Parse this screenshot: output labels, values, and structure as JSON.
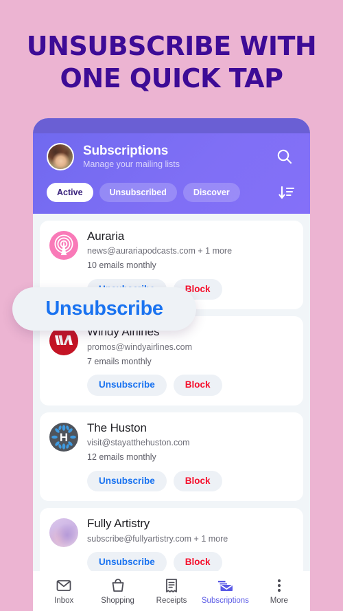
{
  "headline": {
    "line1": "Unsubscribe with",
    "line2": "One Quick Tap"
  },
  "colors": {
    "background_pink": "#ecb4d2",
    "headline_purple": "#3d0b96",
    "header_purple": "#7f6ff5",
    "status_bar_purple": "#6a5fd4",
    "accent_blue": "#1a73f0",
    "accent_red": "#f5102c",
    "nav_active": "#5a5ae6",
    "list_background": "#f1f5f8"
  },
  "app": {
    "header": {
      "avatar_name": "user-avatar",
      "title": "Subscriptions",
      "subtitle": "Manage your mailing lists",
      "search_icon": "search-icon",
      "sort_icon": "sort-descending-icon"
    },
    "filters": [
      {
        "label": "Active",
        "selected": true
      },
      {
        "label": "Unsubscribed",
        "selected": false
      },
      {
        "label": "Discover",
        "selected": false
      }
    ],
    "subscriptions": [
      {
        "name": "Auraria",
        "email": "news@aurariapodcasts.com + 1 more",
        "frequency": "10 emails monthly",
        "logo": "podcast-broadcast-icon",
        "unsubscribe_label": "Unsubscribe",
        "block_label": "Block"
      },
      {
        "name": "Windy Airlines",
        "email": "promos@windyairlines.com",
        "frequency": "7 emails monthly",
        "logo": "windy-airlines-monogram",
        "unsubscribe_label": "Unsubscribe",
        "block_label": "Block"
      },
      {
        "name": "The Huston",
        "email": "visit@stayatthehuston.com",
        "frequency": "12 emails monthly",
        "logo": "huston-hotel-monogram",
        "unsubscribe_label": "Unsubscribe",
        "block_label": "Block"
      },
      {
        "name": "Fully Artistry",
        "email": "subscribe@fullyartistry.com + 1 more",
        "frequency": "",
        "logo": "artistry-abstract-photo",
        "unsubscribe_label": "Unsubscribe",
        "block_label": "Block"
      }
    ],
    "callout": {
      "label": "Unsubscribe"
    },
    "bottom_nav": [
      {
        "label": "Inbox",
        "icon": "envelope-icon",
        "active": false
      },
      {
        "label": "Shopping",
        "icon": "shopping-bag-icon",
        "active": false
      },
      {
        "label": "Receipts",
        "icon": "receipt-icon",
        "active": false
      },
      {
        "label": "Subscriptions",
        "icon": "subscriptions-envelope-icon",
        "active": true
      },
      {
        "label": "More",
        "icon": "more-dots-icon",
        "active": false
      }
    ]
  }
}
